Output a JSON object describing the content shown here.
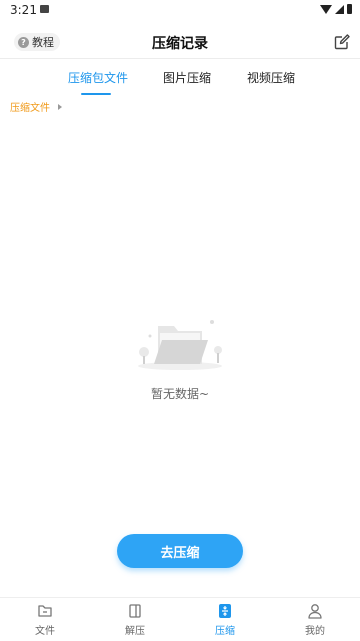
{
  "status_bar": {
    "time": "3:21"
  },
  "header": {
    "tutorial_label": "教程",
    "title": "压缩记录"
  },
  "tabs": [
    {
      "label": "压缩包文件",
      "active": true
    },
    {
      "label": "图片压缩",
      "active": false
    },
    {
      "label": "视频压缩",
      "active": false
    }
  ],
  "breadcrumb": {
    "label": "压缩文件"
  },
  "empty_state": {
    "message": "暂无数据~"
  },
  "cta": {
    "label": "去压缩"
  },
  "bottom_nav": [
    {
      "label": "文件",
      "icon": "folder-icon",
      "active": false
    },
    {
      "label": "解压",
      "icon": "book-icon",
      "active": false
    },
    {
      "label": "压缩",
      "icon": "compress-icon",
      "active": true
    },
    {
      "label": "我的",
      "icon": "person-icon",
      "active": false
    }
  ],
  "colors": {
    "accent": "#1e96ec",
    "button": "#2ea4f5",
    "breadcrumb": "#f09a1a"
  }
}
